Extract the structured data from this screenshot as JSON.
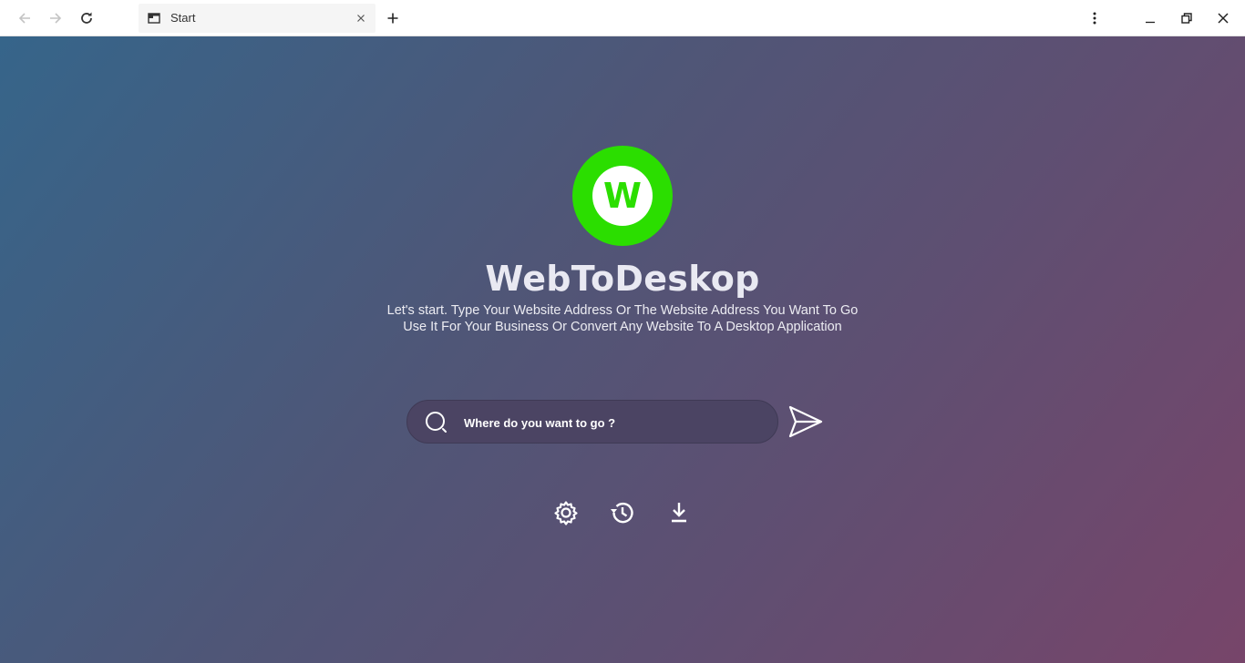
{
  "browser": {
    "tab_title": "Start",
    "icons": {
      "back": "back-arrow-icon",
      "forward": "forward-arrow-icon",
      "reload": "reload-icon",
      "tab": "window-tab-icon",
      "close_tab": "close-icon",
      "new_tab": "plus-icon",
      "menu": "kebab-menu-icon",
      "minimize": "minimize-icon",
      "restore": "restore-icon",
      "close_window": "close-icon"
    }
  },
  "app": {
    "logo_letter": "W",
    "title": "WebToDeskop",
    "subtitle_line1": "Let's start. Type Your Website Address Or The Website Address You Want To Go",
    "subtitle_line2": "Use It For Your Business Or Convert Any Website To A Desktop Application"
  },
  "search": {
    "placeholder": "Where do you want to go ?",
    "value": "",
    "icon": "search-icon",
    "submit_icon": "send-icon"
  },
  "actions": [
    {
      "icon": "gear-icon"
    },
    {
      "icon": "history-icon"
    },
    {
      "icon": "download-icon"
    }
  ],
  "colors": {
    "logo": "#2bde00",
    "gradient_start": "#36658a",
    "gradient_end": "#77456a",
    "search_bg": "#4b4463"
  }
}
